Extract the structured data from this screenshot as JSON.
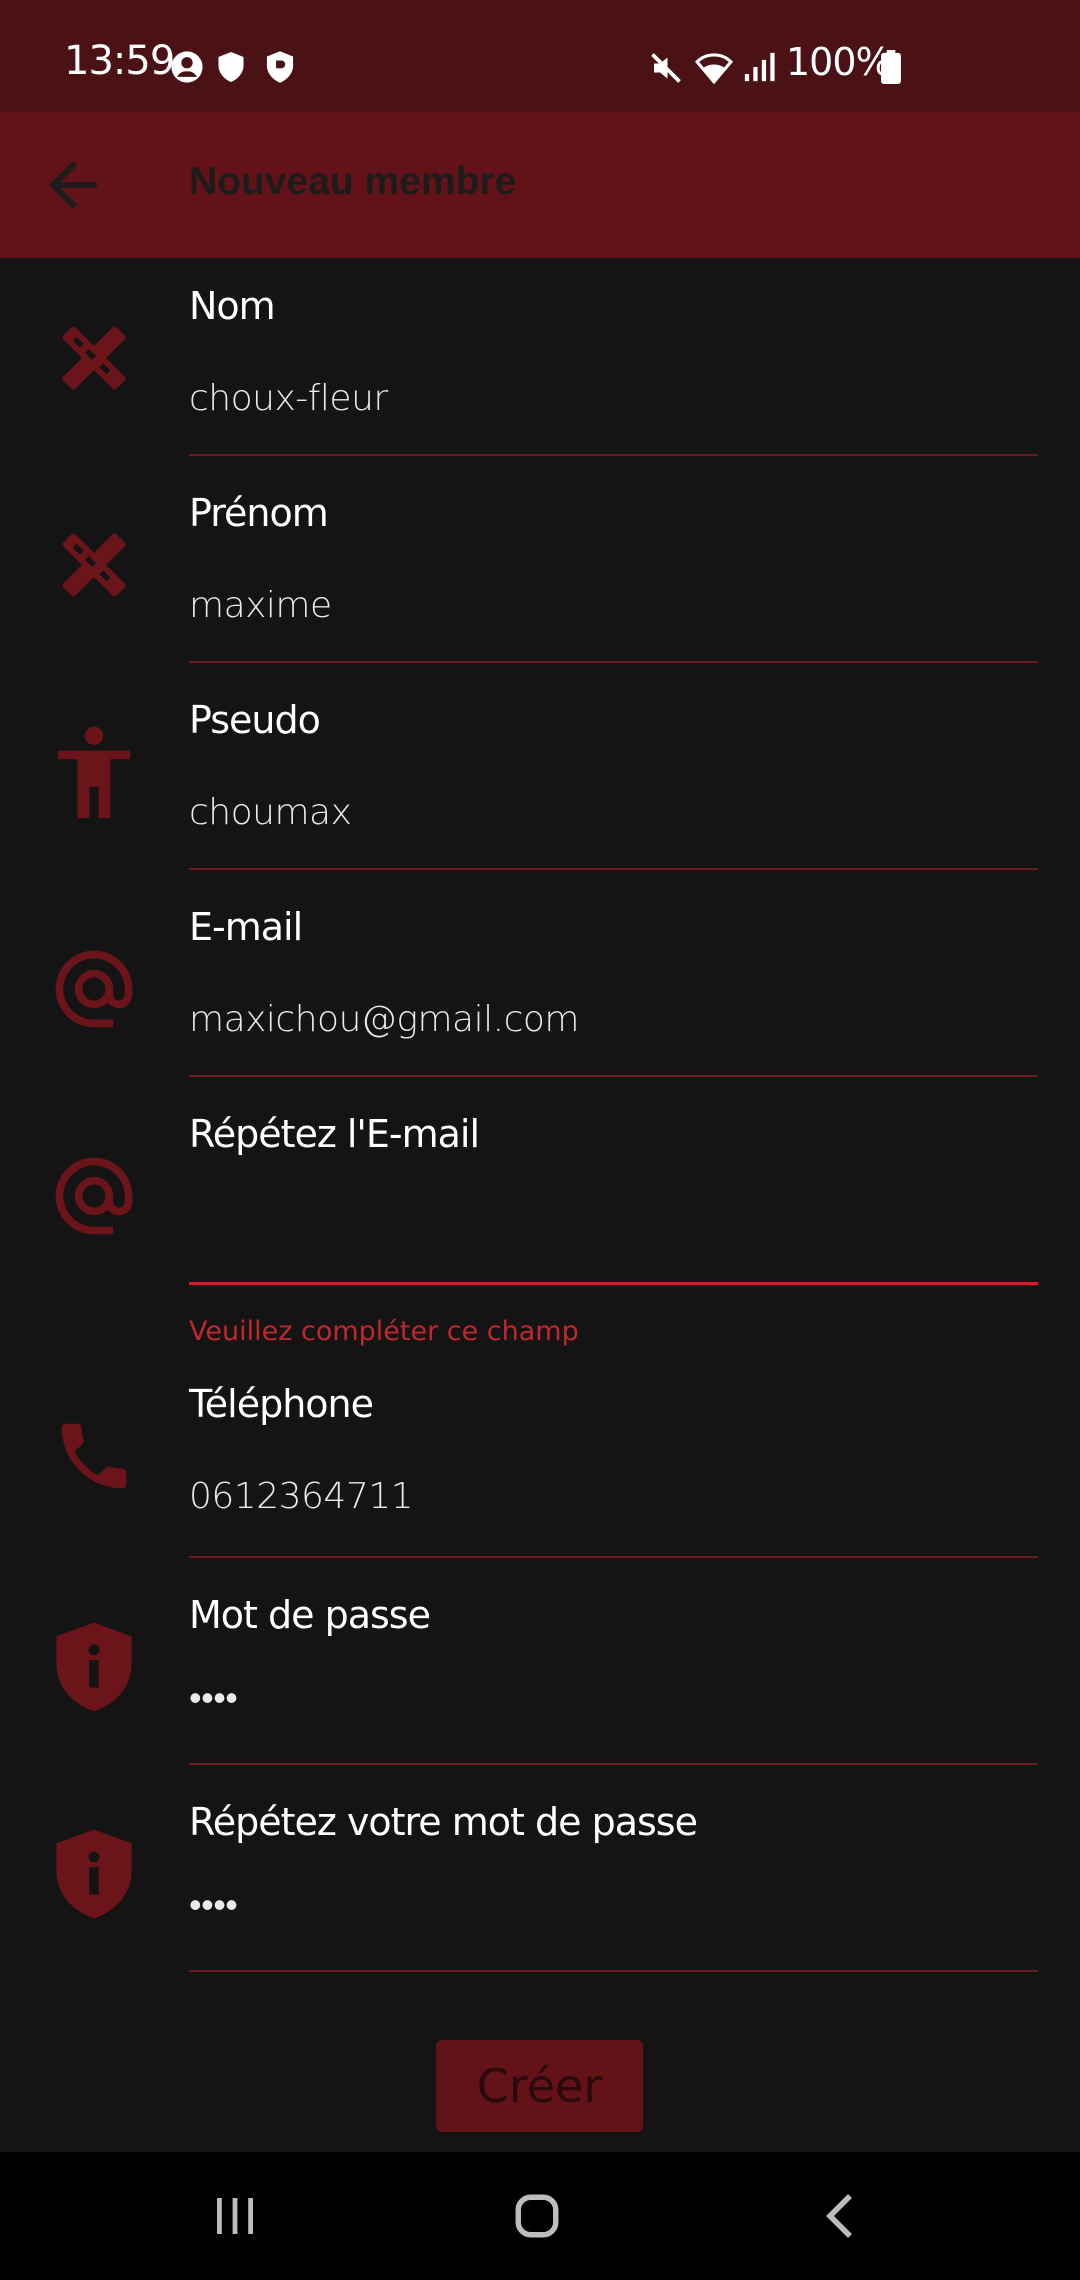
{
  "status_bar": {
    "time": "13:59",
    "battery": "100%",
    "icons": [
      "account-circle-icon",
      "shield-icon",
      "shield-b-icon",
      "mute-icon",
      "wifi-icon",
      "signal-icon",
      "battery-icon"
    ]
  },
  "app_bar": {
    "title": "Nouveau membre",
    "back_icon": "arrow-back-icon"
  },
  "colors": {
    "status_bar": "#4a1215",
    "app_bar": "#631318",
    "background": "#141414",
    "icon": "#6b1419",
    "divider": "#6e1a22",
    "error": "#c0272d"
  },
  "form": {
    "fields": [
      {
        "label": "Nom",
        "value": "choux-fleur",
        "icon": "ruler-pencil-icon"
      },
      {
        "label": "Prénom",
        "value": "maxime",
        "icon": "ruler-pencil-icon"
      },
      {
        "label": "Pseudo",
        "value": "choumax",
        "icon": "person-icon"
      },
      {
        "label": "E-mail",
        "value": "maxichou@gmail.com",
        "icon": "at-icon"
      },
      {
        "label": "Répétez l'E-mail",
        "value": "",
        "icon": "at-icon",
        "error": "Veuillez compléter ce champ"
      },
      {
        "label": "Téléphone",
        "value": "0612364711",
        "icon": "phone-icon"
      },
      {
        "label": "Mot de passe",
        "value": "••••",
        "icon": "shield-info-icon"
      },
      {
        "label": "Répétez votre mot de passe",
        "value": "••••",
        "icon": "shield-info-icon"
      }
    ],
    "submit_label": "Créer"
  },
  "nav_bar": {
    "buttons": [
      "recents-icon",
      "home-icon",
      "back-icon"
    ]
  }
}
